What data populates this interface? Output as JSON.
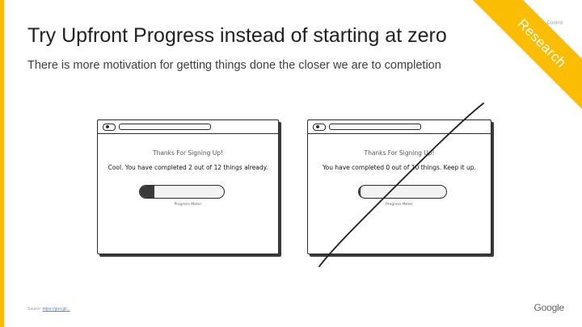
{
  "slide": {
    "title": "Try Upfront Progress instead of starting at zero",
    "subtitle": "There is more motivation for getting things done the closer we are to completion",
    "corner_label": "Research",
    "corner_tag": "Control",
    "source_label": "Source:",
    "source_link": "https://goo.gl/...",
    "logo": "Google"
  },
  "colors": {
    "accent": "#fbbc04",
    "link": "#4285f4"
  },
  "mockups": [
    {
      "heading": "Thanks For Signing Up!",
      "message": "Cool. You have completed 2 out of 12 things already.",
      "meter_label": "Progress Meter",
      "progress": 0.17,
      "crossed_out": false
    },
    {
      "heading": "Thanks For Signing Up!",
      "message": "You have completed 0 out of 10 things. Keep it up.",
      "meter_label": "Progress Meter",
      "progress": 0.0,
      "crossed_out": true
    }
  ]
}
